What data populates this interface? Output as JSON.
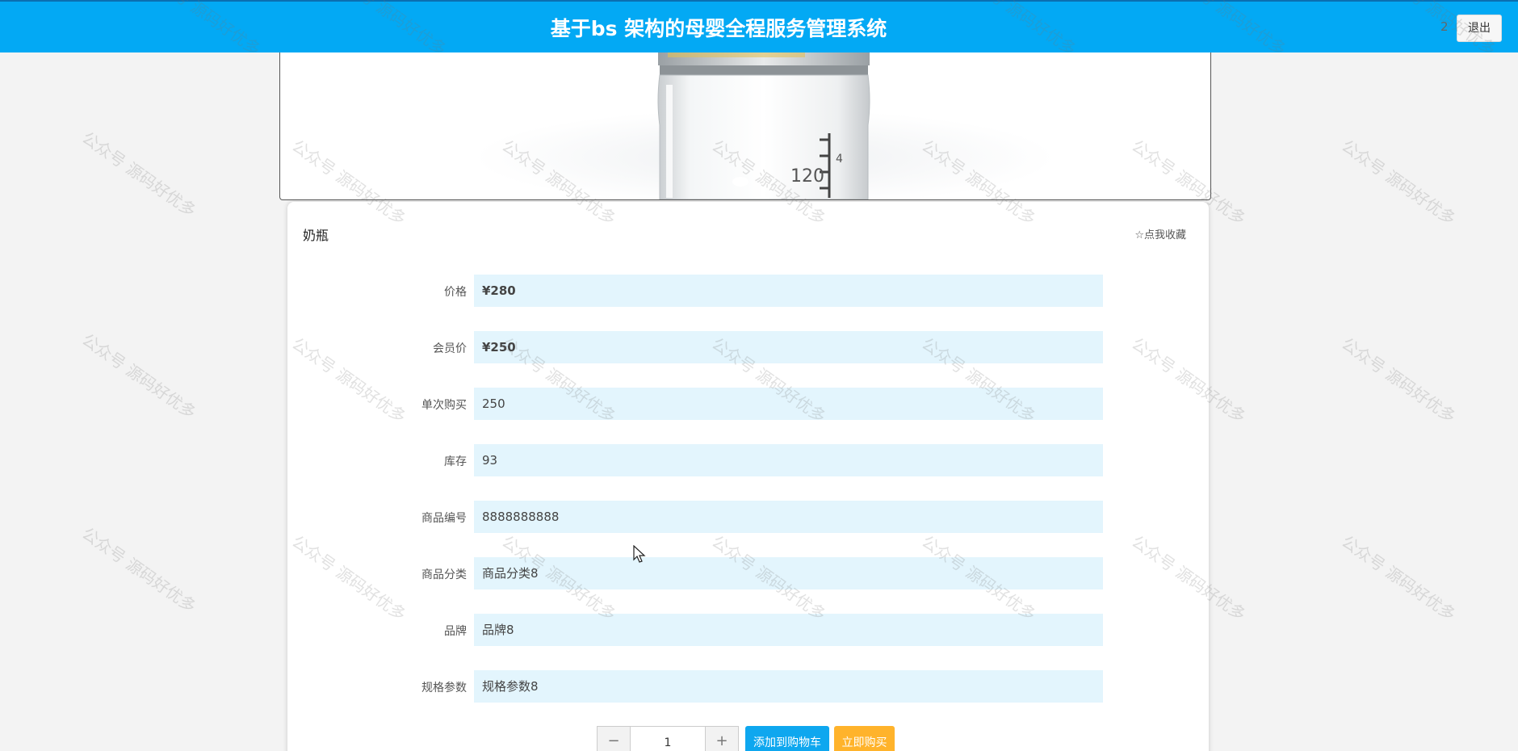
{
  "header": {
    "title": "基于bs 架构的母婴全程服务管理系统",
    "user_id": "2",
    "logout_label": "退出"
  },
  "product": {
    "name": "奶瓶",
    "favorite_label": "☆点我收藏",
    "hero_image_alt": "奶瓶",
    "bottle_marking": "120"
  },
  "details": [
    {
      "label": "价格",
      "value": "¥280"
    },
    {
      "label": "会员价",
      "value": "¥250"
    },
    {
      "label": "单次购买",
      "value": "250"
    },
    {
      "label": "库存",
      "value": "93"
    },
    {
      "label": "商品编号",
      "value": "8888888888"
    },
    {
      "label": "商品分类",
      "value": "商品分类8"
    },
    {
      "label": "品牌",
      "value": "品牌8"
    },
    {
      "label": "规格参数",
      "value": "规格参数8"
    }
  ],
  "purchase": {
    "minus_symbol": "−",
    "quantity": "1",
    "plus_symbol": "+",
    "add_to_cart_label": "添加到购物车",
    "buy_now_label": "立即购买"
  },
  "watermark_text": "公众号 源码好优多",
  "colors": {
    "header_bg": "#03a9f4",
    "field_bg": "#e3f5fd",
    "cart_button": "#0ea7ef",
    "buy_button": "#ffb32b"
  }
}
